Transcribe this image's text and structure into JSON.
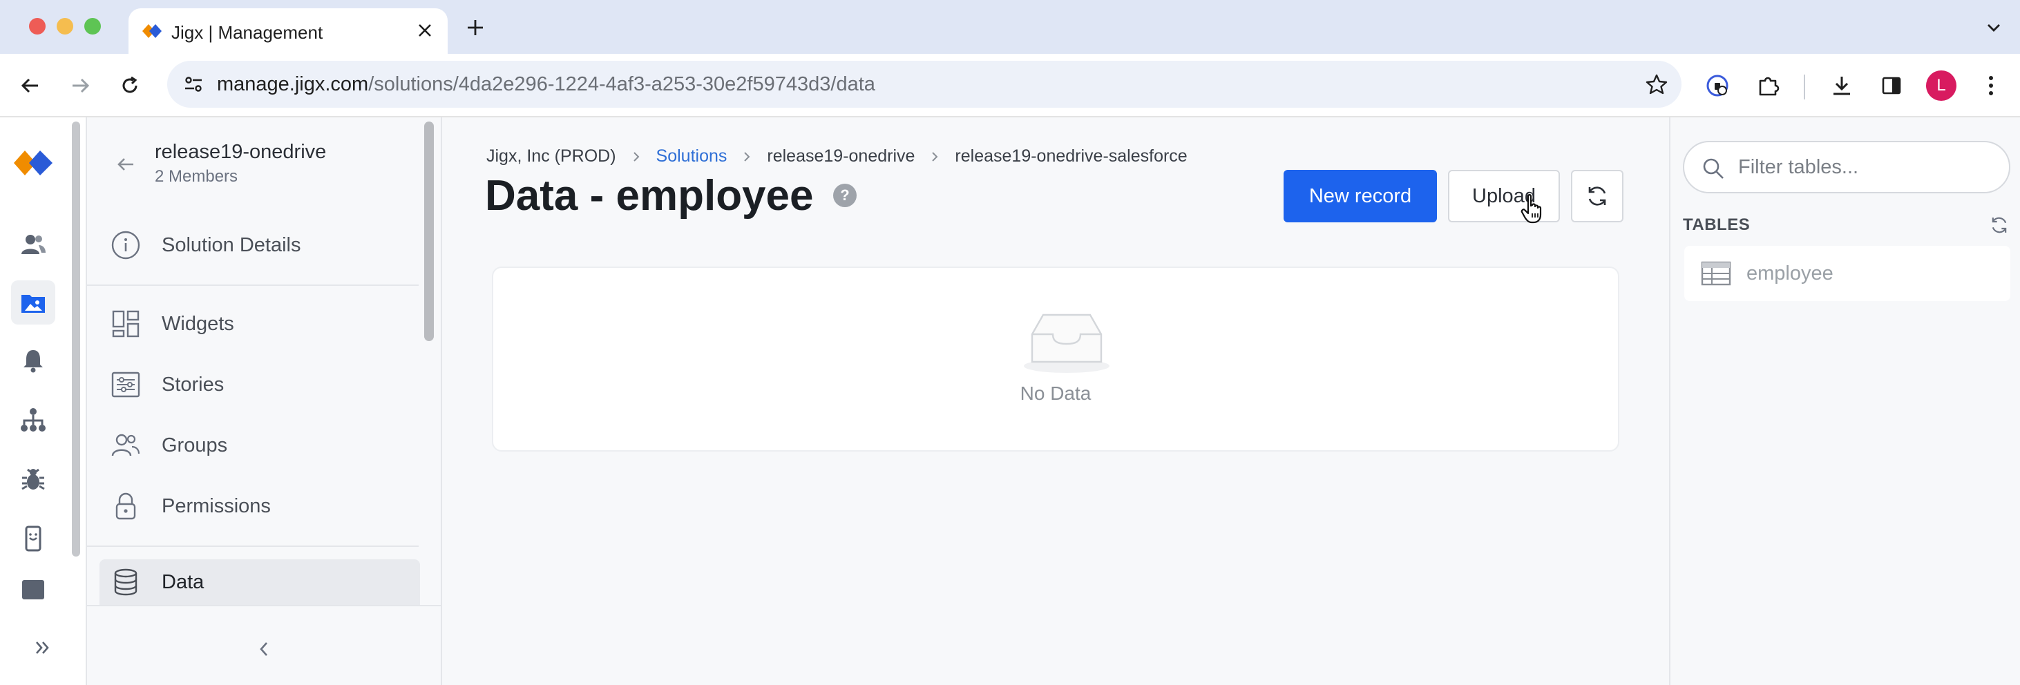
{
  "browser": {
    "tab_title": "Jigx | Management",
    "url_host": "manage.jigx.com",
    "url_path": "/solutions/4da2e296-1224-4af3-a253-30e2f59743d3/data",
    "profile_initial": "L",
    "colors": {
      "tabbar": "#dfe6f5",
      "omnibox": "#edf1f9",
      "profile": "#d81b60"
    }
  },
  "rail": {
    "icons": [
      "users-icon",
      "solutions-icon",
      "notifications-icon",
      "org-chart-icon",
      "bug-icon",
      "mobile-device-icon"
    ],
    "active": "solutions-icon"
  },
  "sidebar": {
    "solution_name": "release19-onedrive",
    "members": "2 Members",
    "items": [
      {
        "label": "Solution Details",
        "icon": "info-icon"
      },
      {
        "label": "Widgets",
        "icon": "widgets-icon"
      },
      {
        "label": "Stories",
        "icon": "stories-icon"
      },
      {
        "label": "Groups",
        "icon": "groups-icon"
      },
      {
        "label": "Permissions",
        "icon": "lock-icon"
      },
      {
        "label": "Data",
        "icon": "database-icon",
        "active": true
      }
    ]
  },
  "main": {
    "breadcrumbs": [
      "Jigx, Inc (PROD)",
      "Solutions",
      "release19-onedrive",
      "release19-onedrive-salesforce"
    ],
    "title": "Data - employee",
    "help": "?",
    "new_record_label": "New record",
    "upload_label": "Upload",
    "empty_text": "No Data",
    "colors": {
      "primary": "#1d63ed",
      "link": "#2f6fd6"
    }
  },
  "right_panel": {
    "filter_placeholder": "Filter tables...",
    "tables_heading": "TABLES",
    "tables": [
      "employee"
    ]
  }
}
